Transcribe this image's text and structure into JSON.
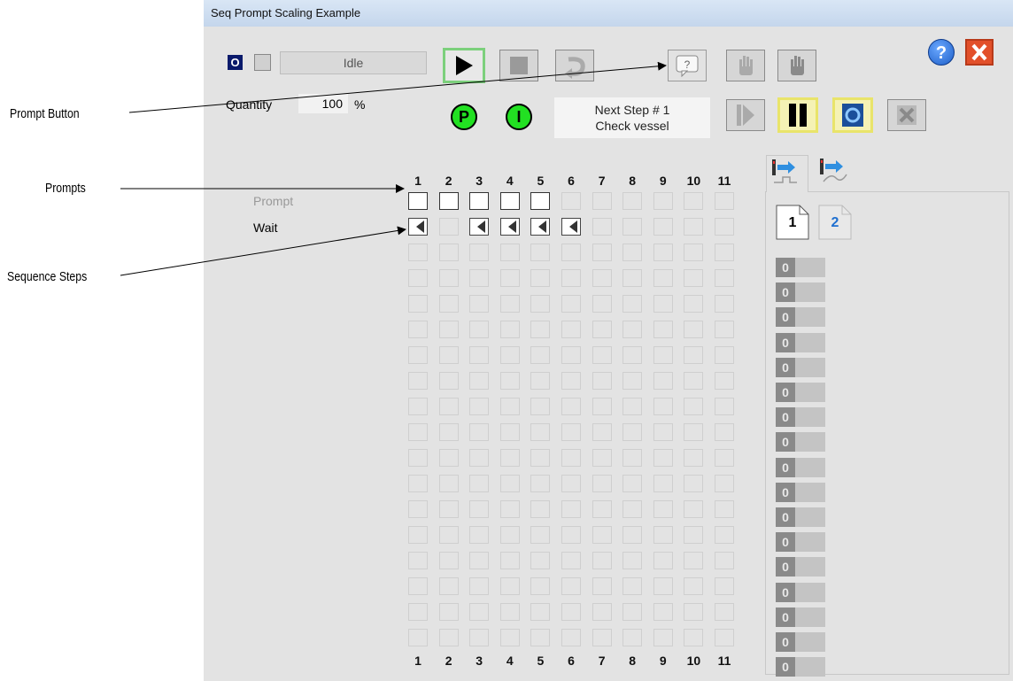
{
  "callouts": {
    "prompt_button": "Prompt Button",
    "prompts": "Prompts",
    "sequence_steps": "Sequence Steps"
  },
  "window": {
    "title": "Seq Prompt Scaling Example"
  },
  "status": {
    "mode_indicator": "O",
    "state": "Idle"
  },
  "quantity": {
    "label": "Quantity",
    "value": "100",
    "unit": "%"
  },
  "indicators": {
    "p": "P",
    "i": "I"
  },
  "next_step": {
    "line1": "Next Step # 1",
    "line2": "Check vessel"
  },
  "toolbar": {
    "help": "?",
    "prompt_icon_text": "?"
  },
  "grid": {
    "columns": [
      "1",
      "2",
      "3",
      "4",
      "5",
      "6",
      "7",
      "8",
      "9",
      "10",
      "11"
    ],
    "row_labels": {
      "prompt": "Prompt",
      "wait": "Wait"
    },
    "prompt_cells": [
      1,
      1,
      1,
      1,
      1,
      0,
      0,
      0,
      0,
      0,
      0
    ],
    "wait_cells": [
      1,
      0,
      1,
      1,
      1,
      1,
      0,
      0,
      0,
      0,
      0
    ]
  },
  "side_panel": {
    "pages": [
      "1",
      "2"
    ],
    "counters": [
      "0",
      "0",
      "0",
      "0",
      "0",
      "0",
      "0",
      "0",
      "0",
      "0",
      "0",
      "0",
      "0",
      "0",
      "0",
      "0",
      "0"
    ]
  },
  "colors": {
    "run_green": "#22e022",
    "help_blue": "#1e5fc8",
    "close_orange": "#e2502a"
  }
}
